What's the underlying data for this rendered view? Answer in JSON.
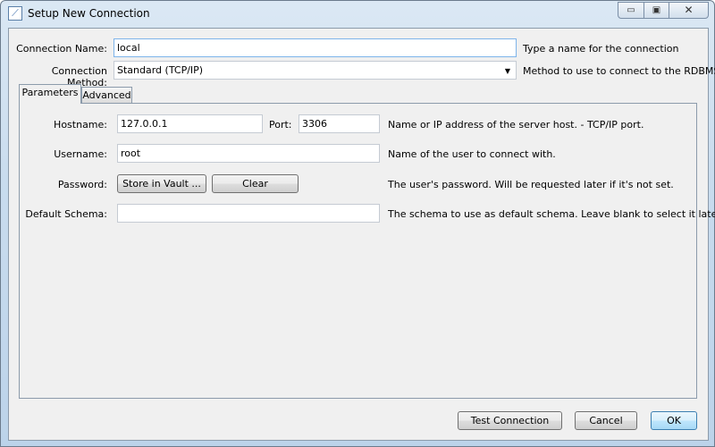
{
  "window": {
    "title": "Setup New Connection",
    "icon": "mysql-workbench-icon",
    "controls": [
      "minimize",
      "maximize",
      "close"
    ]
  },
  "form": {
    "connection_name": {
      "label": "Connection Name:",
      "value": "local",
      "hint": "Type a name for the connection"
    },
    "connection_method": {
      "label": "Connection Method:",
      "value": "Standard (TCP/IP)",
      "hint": "Method to use to connect to the RDBMS"
    }
  },
  "tabs": [
    {
      "label": "Parameters",
      "active": true
    },
    {
      "label": "Advanced",
      "active": false
    }
  ],
  "parameters": {
    "hostname": {
      "label": "Hostname:",
      "value": "127.0.0.1"
    },
    "port": {
      "label": "Port:",
      "value": "3306"
    },
    "host_hint": "Name or IP address of the server host. - TCP/IP port.",
    "username": {
      "label": "Username:",
      "value": "root",
      "hint": "Name of the user to connect with."
    },
    "password": {
      "label": "Password:",
      "store_label": "Store in Vault ...",
      "clear_label": "Clear",
      "hint": "The user's password. Will be requested later if it's not set."
    },
    "default_schema": {
      "label": "Default Schema:",
      "value": "",
      "hint": "The schema to use as default schema. Leave blank to select it later."
    }
  },
  "footer": {
    "test_label": "Test Connection",
    "cancel_label": "Cancel",
    "ok_label": "OK"
  }
}
